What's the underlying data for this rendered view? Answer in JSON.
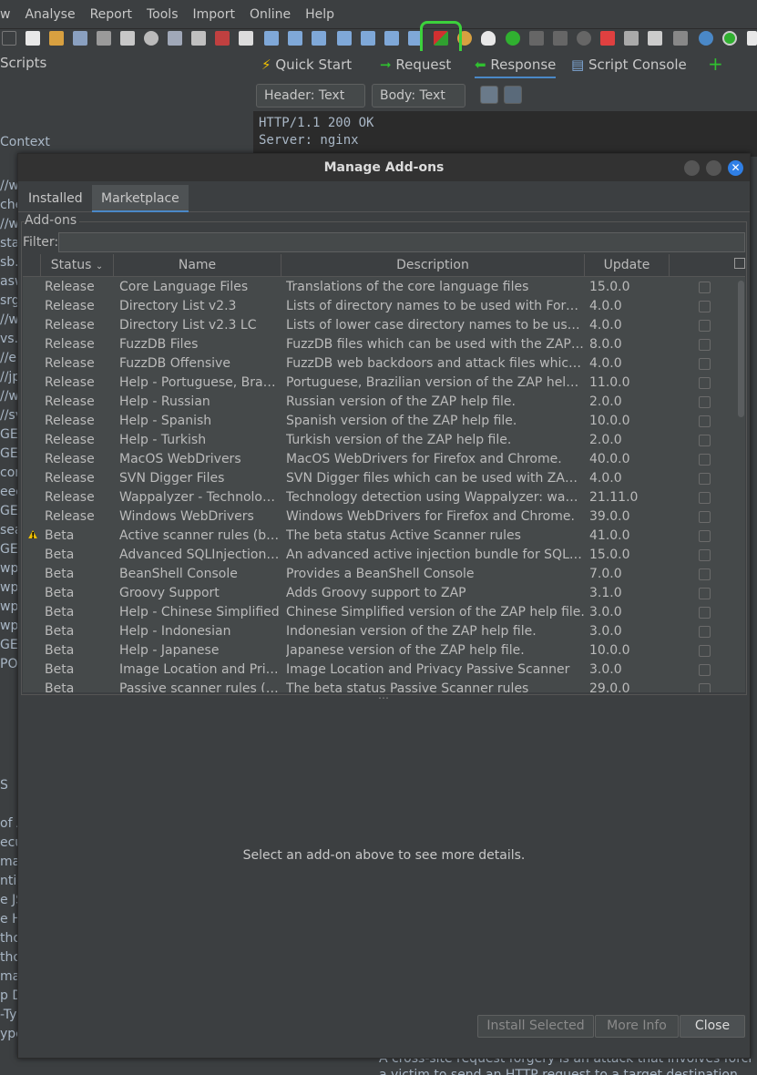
{
  "menubar": {
    "items": [
      "w",
      "Analyse",
      "Report",
      "Tools",
      "Import",
      "Online",
      "Help"
    ]
  },
  "toolbar": {
    "highlighted_icon": "manage-addons-icon"
  },
  "sites_panel": {
    "title": "Scripts",
    "context_label": "Context",
    "lines": [
      "//w",
      "che",
      "//w",
      "stat",
      "sb.s",
      "asw",
      "srgs",
      "//w",
      "vs.",
      "//e",
      "//jp",
      "//w",
      "//sv",
      "GET",
      "GET",
      "com",
      "eed",
      "GET",
      "sea",
      "GET",
      "wp-",
      "wp-",
      "wp-",
      "wp-",
      "GET",
      "POS"
    ],
    "lower_lines": [
      "S",
      "",
      "of A",
      "ecu",
      "ma",
      "nti-",
      "e JS",
      "e Ht",
      "thod",
      "thod",
      "ma",
      "p D",
      "-Ty",
      "ype Header Missing"
    ]
  },
  "request_tabs": {
    "quick_start": "Quick Start",
    "request": "Request",
    "response": "Response",
    "script_console": "Script Console"
  },
  "response_view": {
    "header_combo": "Header: Text",
    "body_combo": "Body: Text",
    "lines": [
      "HTTP/1.1 200 OK",
      "Server: nginx"
    ]
  },
  "bottom_text": {
    "line1": "A cross-site request forgery is an attack that involves forcing",
    "line2": "a victim to send an HTTP request to a target destination"
  },
  "dialog": {
    "title": "Manage Add-ons",
    "tabs": [
      "Installed",
      "Marketplace"
    ],
    "selected_tab": "Marketplace",
    "addons_label": "Add-ons",
    "filter_label": "Filter:",
    "filter_value": "",
    "columns": {
      "status": "Status",
      "name": "Name",
      "description": "Description",
      "update": "Update"
    },
    "rows": [
      {
        "warn": false,
        "status": "Release",
        "name": "Core Language Files",
        "description": "Translations of the core language files",
        "update": "15.0.0"
      },
      {
        "warn": false,
        "status": "Release",
        "name": "Directory List v2.3",
        "description": "Lists of directory names to be used with Forced ...",
        "update": "4.0.0"
      },
      {
        "warn": false,
        "status": "Release",
        "name": "Directory List v2.3 LC",
        "description": "Lists of lower case directory names to be used w...",
        "update": "4.0.0"
      },
      {
        "warn": false,
        "status": "Release",
        "name": "FuzzDB Files",
        "description": "FuzzDB files which can be used with the ZAP fuz...",
        "update": "8.0.0"
      },
      {
        "warn": false,
        "status": "Release",
        "name": "FuzzDB Offensive",
        "description": "FuzzDB web backdoors and attack files which ca...",
        "update": "4.0.0"
      },
      {
        "warn": false,
        "status": "Release",
        "name": "Help - Portuguese, Brazil...",
        "description": "Portuguese, Brazilian version of the ZAP help file.",
        "update": "11.0.0"
      },
      {
        "warn": false,
        "status": "Release",
        "name": "Help - Russian",
        "description": "Russian version of the ZAP help file.",
        "update": "2.0.0"
      },
      {
        "warn": false,
        "status": "Release",
        "name": "Help - Spanish",
        "description": "Spanish version of the ZAP help file.",
        "update": "10.0.0"
      },
      {
        "warn": false,
        "status": "Release",
        "name": "Help - Turkish",
        "description": "Turkish version of the ZAP help file.",
        "update": "2.0.0"
      },
      {
        "warn": false,
        "status": "Release",
        "name": "MacOS WebDrivers",
        "description": "MacOS WebDrivers for Firefox and Chrome.",
        "update": "40.0.0"
      },
      {
        "warn": false,
        "status": "Release",
        "name": "SVN Digger Files",
        "description": "SVN Digger files which can be used with ZAP for...",
        "update": "4.0.0"
      },
      {
        "warn": false,
        "status": "Release",
        "name": "Wappalyzer - Technology...",
        "description": "Technology detection using Wappalyzer: wappal...",
        "update": "21.11.0"
      },
      {
        "warn": false,
        "status": "Release",
        "name": "Windows WebDrivers",
        "description": "Windows WebDrivers for Firefox and Chrome.",
        "update": "39.0.0"
      },
      {
        "warn": true,
        "status": "Beta",
        "name": "Active scanner rules (beta)",
        "description": "The beta status Active Scanner rules",
        "update": "41.0.0"
      },
      {
        "warn": false,
        "status": "Beta",
        "name": "Advanced SQLInjection S...",
        "description": "An advanced active injection bundle for SQLi (der...",
        "update": "15.0.0"
      },
      {
        "warn": false,
        "status": "Beta",
        "name": "BeanShell Console",
        "description": "Provides a BeanShell Console",
        "update": "7.0.0"
      },
      {
        "warn": false,
        "status": "Beta",
        "name": "Groovy Support",
        "description": "Adds Groovy support to ZAP",
        "update": "3.1.0"
      },
      {
        "warn": false,
        "status": "Beta",
        "name": "Help - Chinese Simplified",
        "description": "Chinese Simplified version of the ZAP help file.",
        "update": "3.0.0"
      },
      {
        "warn": false,
        "status": "Beta",
        "name": "Help - Indonesian",
        "description": "Indonesian version of the ZAP help file.",
        "update": "3.0.0"
      },
      {
        "warn": false,
        "status": "Beta",
        "name": "Help - Japanese",
        "description": "Japanese version of the ZAP help file.",
        "update": "10.0.0"
      },
      {
        "warn": false,
        "status": "Beta",
        "name": "Image Location and Priva...",
        "description": "Image Location and Privacy Passive Scanner",
        "update": "3.0.0"
      },
      {
        "warn": false,
        "status": "Beta",
        "name": "Passive scanner rules (be...",
        "description": "The beta status Passive Scanner rules",
        "update": "29.0.0"
      }
    ],
    "details_message": "Select an add-on above to see more details.",
    "buttons": {
      "install": "Install Selected",
      "more_info": "More Info",
      "close": "Close"
    }
  },
  "colors": {
    "accent": "#4a88c7",
    "highlight_ring": "#3cd13c",
    "warning": "#f0c000"
  }
}
